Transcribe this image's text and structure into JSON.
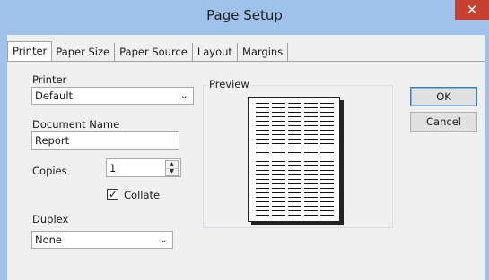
{
  "window": {
    "title": "Page Setup",
    "close_glyph": "✕"
  },
  "tabs": [
    {
      "label": "Printer",
      "active": true
    },
    {
      "label": "Paper Size",
      "active": false
    },
    {
      "label": "Paper Source",
      "active": false
    },
    {
      "label": "Layout",
      "active": false
    },
    {
      "label": "Margins",
      "active": false
    }
  ],
  "printer": {
    "label": "Printer",
    "value": "Default"
  },
  "document_name": {
    "label": "Document Name",
    "value": "Report"
  },
  "copies": {
    "label": "Copies",
    "value": "1"
  },
  "collate": {
    "label": "Collate",
    "checked": true
  },
  "duplex": {
    "label": "Duplex",
    "value": "None"
  },
  "preview": {
    "label": "Preview"
  },
  "buttons": {
    "ok": "OK",
    "cancel": "Cancel"
  },
  "icons": {
    "dropdown": "chevron-down-icon",
    "close": "close-icon",
    "check": "checkmark-icon"
  },
  "colors": {
    "titlebar": "#9ec2ea",
    "close": "#c84031",
    "client": "#f0f0f0"
  }
}
